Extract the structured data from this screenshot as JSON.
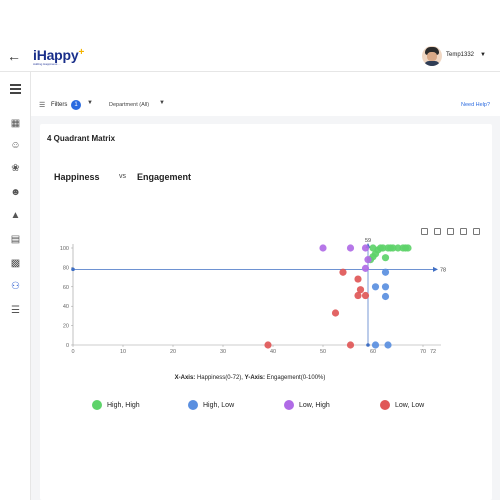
{
  "app": {
    "logo": "iHappy",
    "logo_plus": "+",
    "tagline": "Adding Happiness ..."
  },
  "user": {
    "name": "Temp1332"
  },
  "filters": {
    "label": "Filters",
    "count": "1",
    "department": "Department (All)",
    "help": "Need Help?"
  },
  "card": {
    "title": "4 Quadrant Matrix",
    "x_name": "Happiness",
    "vs": "vs",
    "y_name": "Engagement"
  },
  "axis_caption": {
    "x_key": "X-Axis:",
    "x_text": "Happiness(0-72),",
    "y_key": "Y-Axis:",
    "y_text": "Engagement(0-100%)"
  },
  "colors": {
    "high_high": "#5ed36a",
    "high_low": "#5a8fe0",
    "low_high": "#b06be6",
    "low_low": "#e05757",
    "axis_blue": "#3f6fc4"
  },
  "chart_data": {
    "type": "scatter",
    "title": "",
    "xlim": [
      0,
      72
    ],
    "ylim": [
      0,
      100
    ],
    "x_ticks": [
      0,
      10,
      20,
      30,
      40,
      50,
      60,
      70
    ],
    "x_max_label": "72",
    "y_ticks": [
      0,
      20,
      40,
      60,
      80,
      100
    ],
    "reference_lines": {
      "x": 59,
      "y": 78,
      "x_label": "59",
      "y_label": "78"
    },
    "series": [
      {
        "name": "High, High",
        "color": "#5ed36a",
        "points": [
          [
            59.5,
            88
          ],
          [
            60,
            91
          ],
          [
            60.5,
            94
          ],
          [
            61,
            98
          ],
          [
            61.5,
            100
          ],
          [
            62,
            100
          ],
          [
            63,
            100
          ],
          [
            64,
            100
          ],
          [
            65,
            100
          ],
          [
            66,
            100
          ],
          [
            66.5,
            100
          ],
          [
            67,
            100
          ],
          [
            62.5,
            90
          ],
          [
            60,
            100
          ],
          [
            63.5,
            100
          ]
        ]
      },
      {
        "name": "High, Low",
        "color": "#5a8fe0",
        "points": [
          [
            62.5,
            75
          ],
          [
            60.5,
            60
          ],
          [
            62.5,
            60
          ],
          [
            62.5,
            50
          ],
          [
            60.5,
            0
          ],
          [
            63,
            0
          ]
        ]
      },
      {
        "name": "Low, High",
        "color": "#b06be6",
        "points": [
          [
            50,
            100
          ],
          [
            55.5,
            100
          ],
          [
            58.5,
            100
          ],
          [
            59,
            88
          ],
          [
            58.5,
            79
          ]
        ]
      },
      {
        "name": "Low, Low",
        "color": "#e05757",
        "points": [
          [
            54,
            75
          ],
          [
            57,
            68
          ],
          [
            57.5,
            57
          ],
          [
            57,
            51
          ],
          [
            58.5,
            51
          ],
          [
            52.5,
            33
          ],
          [
            39,
            0
          ],
          [
            55.5,
            0
          ]
        ]
      }
    ]
  }
}
